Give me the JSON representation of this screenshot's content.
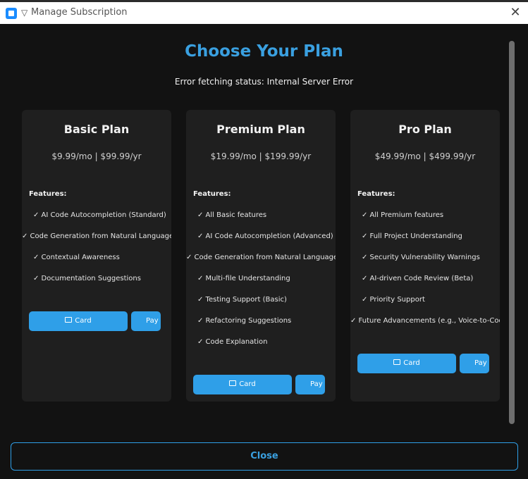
{
  "window": {
    "title": "Manage Subscription",
    "glyph": "▽",
    "close_glyph": "✕"
  },
  "page": {
    "heading": "Choose Your Plan",
    "status": "Error fetching status: Internal Server Error",
    "close_label": "Close"
  },
  "plans": [
    {
      "title": "Basic Plan",
      "price": "$9.99/mo  |  $99.99/yr",
      "features_label": "Features:",
      "features": [
        "✓ AI Code Autocompletion (Standard)",
        "✓ Code Generation from Natural Language (Limited)",
        "✓ Contextual Awareness",
        "✓ Documentation Suggestions"
      ],
      "card_label": "Card",
      "pay_label": "Pay"
    },
    {
      "title": "Premium Plan",
      "price": "$19.99/mo  |  $199.99/yr",
      "features_label": "Features:",
      "features": [
        "✓ All Basic features",
        "✓ AI Code Autocompletion (Advanced)",
        "✓ Code Generation from Natural Language (Extended)",
        "✓ Multi-file Understanding",
        "✓ Testing Support (Basic)",
        "✓ Refactoring Suggestions",
        "✓ Code Explanation"
      ],
      "card_label": "Card",
      "pay_label": "Pay"
    },
    {
      "title": "Pro Plan",
      "price": "$49.99/mo  |  $499.99/yr",
      "features_label": "Features:",
      "features": [
        "✓ All Premium features",
        "✓ Full Project Understanding",
        "✓ Security Vulnerability Warnings",
        "✓ AI-driven Code Review (Beta)",
        "✓ Priority Support",
        "✓ Future Advancements (e.g., Voice-to-Code, Collaboration)"
      ],
      "card_label": "Card",
      "pay_label": "Pay"
    }
  ],
  "colors": {
    "accent": "#3aa0e0",
    "button": "#2f9fe8",
    "background": "#121212",
    "card": "#1f1f1f"
  }
}
